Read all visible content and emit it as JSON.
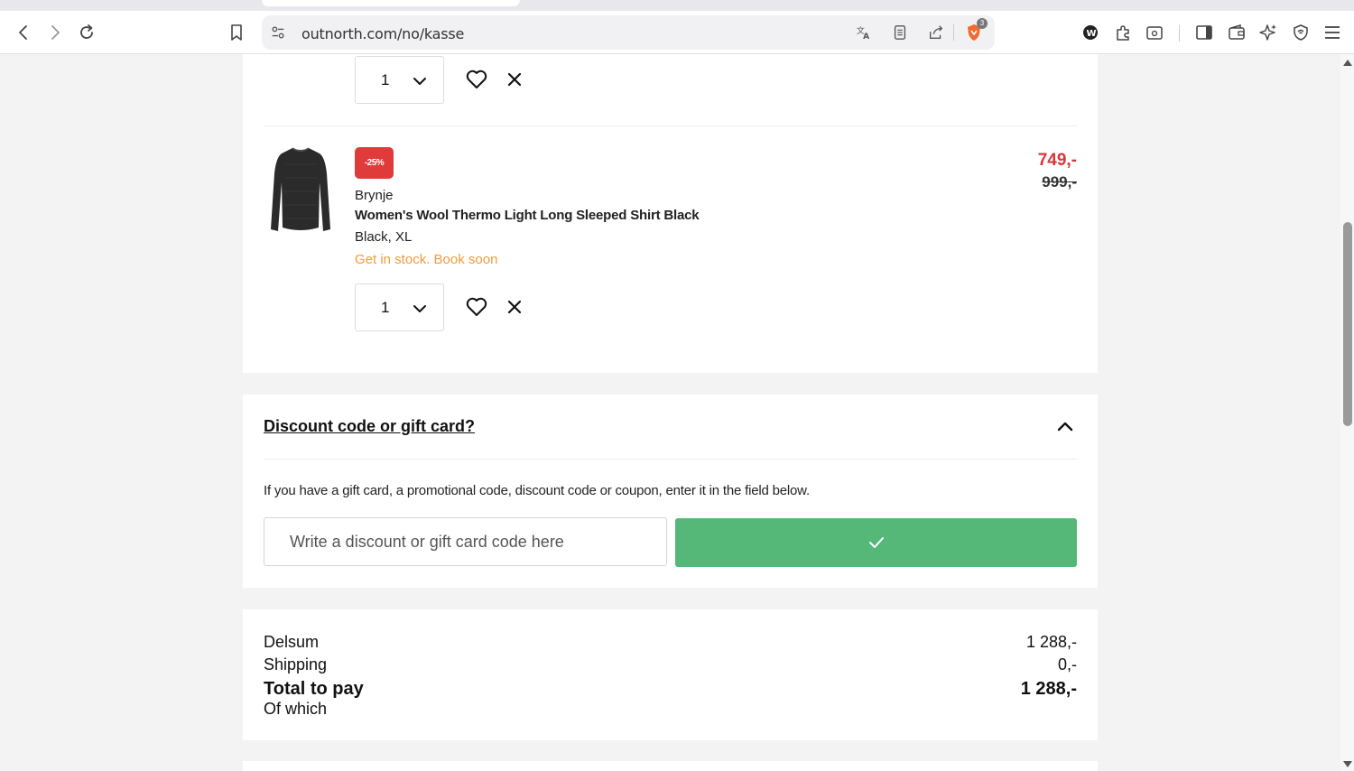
{
  "browser": {
    "url": "outnorth.com/no/kasse",
    "shields_count": "3"
  },
  "cart": {
    "items": [
      {
        "quantity": "1"
      },
      {
        "badge": "-25%",
        "brand": "Brynje",
        "name": "Women's Wool Thermo Light Long Sleeped Shirt Black",
        "variant": "Black, XL",
        "stock": "Get in stock. Book soon",
        "price": "749,-",
        "original_price": "999,-",
        "quantity": "1"
      }
    ]
  },
  "discount": {
    "title": "Discount code or gift card?",
    "help": "If you have a gift card, a promotional code, discount code or coupon, enter it in the field below.",
    "placeholder": "Write a discount or gift card code here",
    "apply_icon": "checkmark-icon"
  },
  "summary": {
    "subtotal_label": "Delsum",
    "subtotal_value": "1 288,-",
    "shipping_label": "Shipping",
    "shipping_value": "0,-",
    "total_label": "Total to pay",
    "total_value": "1 288,-",
    "of_which_label": "Of which"
  },
  "colors": {
    "accent_green": "#56b878",
    "sale_red": "#d93636",
    "stock_orange": "#f29b3a"
  }
}
